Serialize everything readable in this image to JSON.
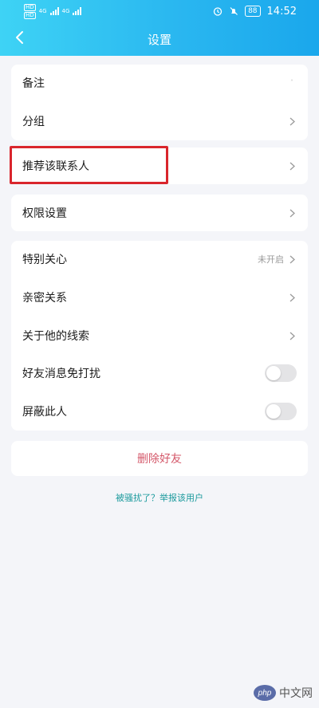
{
  "status_bar": {
    "sim1": "HD",
    "sim2": "HD",
    "network1": "4G",
    "network2": "4G",
    "battery": "88",
    "time": "14:52"
  },
  "nav": {
    "title": "设置",
    "back_icon": "chevron-left-icon"
  },
  "groups": [
    {
      "items": [
        {
          "label": "备注"
        },
        {
          "label": "分组"
        }
      ]
    },
    {
      "items": [
        {
          "label": "推荐该联系人"
        }
      ]
    },
    {
      "items": [
        {
          "label": "权限设置"
        }
      ]
    },
    {
      "items": [
        {
          "label": "特别关心",
          "value": "未开启"
        },
        {
          "label": "亲密关系"
        },
        {
          "label": "关于他的线索"
        },
        {
          "label": "好友消息免打扰",
          "toggle_on": false
        },
        {
          "label": "屏蔽此人",
          "toggle_on": false
        }
      ]
    }
  ],
  "delete_button": "删除好友",
  "report_link": "被骚扰了？举报该用户",
  "watermark": {
    "badge": "php",
    "text": "中文网"
  },
  "colors": {
    "header_start": "#3ed3f5",
    "header_end": "#1aa7ec",
    "delete_text": "#d4586a",
    "report_link": "#1b9a9d",
    "highlight": "#d9252c"
  }
}
